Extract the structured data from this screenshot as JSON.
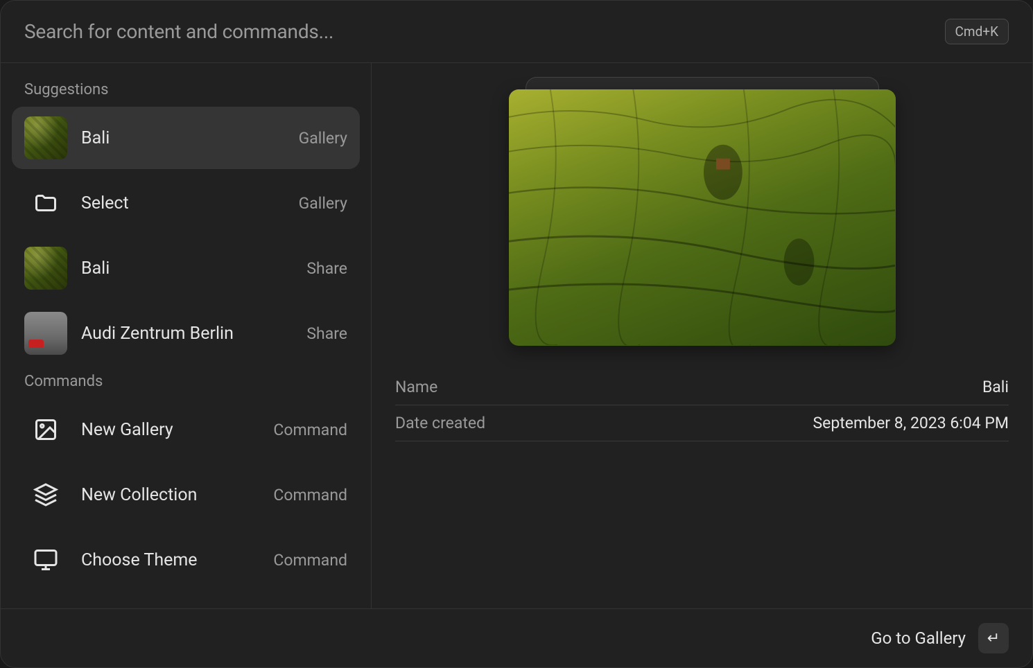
{
  "search": {
    "placeholder": "Search for content and commands...",
    "shortcut": "Cmd+K"
  },
  "sections": {
    "suggestions_title": "Suggestions",
    "commands_title": "Commands"
  },
  "suggestions": [
    {
      "label": "Bali",
      "tag": "Gallery",
      "thumb": "bali",
      "selected": true
    },
    {
      "label": "Select",
      "tag": "Gallery",
      "thumb": "folder",
      "selected": false
    },
    {
      "label": "Bali",
      "tag": "Share",
      "thumb": "bali",
      "selected": false
    },
    {
      "label": "Audi Zentrum Berlin",
      "tag": "Share",
      "thumb": "audi",
      "selected": false
    }
  ],
  "commands": [
    {
      "label": "New Gallery",
      "tag": "Command",
      "icon": "image"
    },
    {
      "label": "New Collection",
      "tag": "Command",
      "icon": "layers"
    },
    {
      "label": "Choose Theme",
      "tag": "Command",
      "icon": "monitor"
    }
  ],
  "preview": {
    "meta": [
      {
        "key": "Name",
        "value": "Bali"
      },
      {
        "key": "Date created",
        "value": "September 8, 2023 6:04 PM"
      }
    ]
  },
  "footer": {
    "action": "Go to Gallery",
    "key_glyph": "↵"
  }
}
